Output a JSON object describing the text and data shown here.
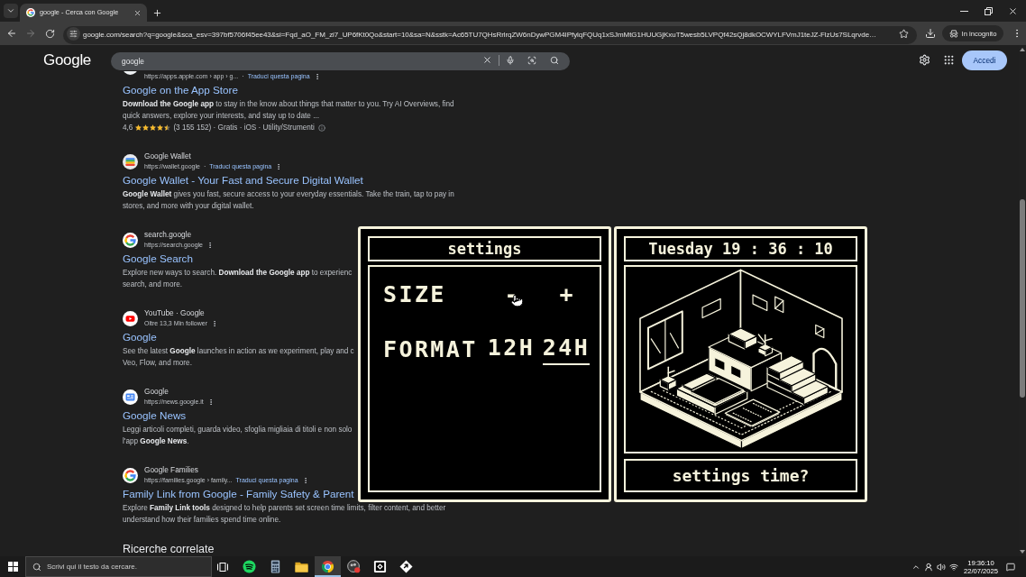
{
  "browser": {
    "tabs": [
      {
        "title": "google - Cerca con Google",
        "selected": true
      }
    ],
    "url": "google.com/search?q=google&sca_esv=397bf5706f45ee43&si=Fqd_aO_FM_zi7_UP6fKt0Qo&start=10&sa=N&sstk=Ac65TU7QHsRrlrqZW6nDywPGM4IPfylqFQUq1xSJmMtG1HUUGjKxuT5wesb5LVPQf42sQj8dkOCWYLFVmJ1teJZ-FlzUs7SLqrvde…",
    "incognito_label": "In incognito"
  },
  "google_header": {
    "logo": "Google",
    "query": "google",
    "sign_in": "Accedi"
  },
  "results": [
    {
      "kind": "cut-off",
      "cite": "https://apps.apple.com › app › g...",
      "cite_separator": "·",
      "translate_link": "Traduci questa pagina",
      "title": "Google on the App Store",
      "snippet_lines": [
        "**Download the Google app** to stay in the know about things that matter to you. Try AI Overviews, find",
        "quick answers, explore your interests, and stay up to date ..."
      ],
      "rating": {
        "score": "4,6",
        "stars": 4.5,
        "details": "(3 155 152) · Gratis · iOS · Utility/Strumenti"
      }
    },
    {
      "kind": "wallet",
      "site": "Google Wallet",
      "cite": "https://wallet.google",
      "cite_separator": "·",
      "translate_link": "Traduci questa pagina",
      "title": "Google Wallet - Your Fast and Secure Digital Wallet",
      "snippet_lines": [
        "**Google Wallet** gives you fast, secure access to your everyday essentials. Take the train, tap to pay in",
        "stores, and more with your digital wallet."
      ]
    },
    {
      "kind": "g",
      "site": "search.google",
      "cite": "https://search.google",
      "title": "Google Search",
      "snippet_lines": [
        "Explore new ways to search. **Download the Google app** to experienc",
        "search, and more."
      ]
    },
    {
      "kind": "video",
      "site": "YouTube · Google",
      "cite": "Oltre 13,3 Mln follower",
      "title": "Google",
      "snippet_lines": [
        "See the latest **Google** launches in action as we experiment, play and c",
        "Veo, Flow, and more."
      ]
    },
    {
      "kind": "news",
      "site": "Google",
      "cite": "https://news.google.it",
      "title": "Google News",
      "snippet_lines": [
        "Leggi articoli completi, guarda video, sfoglia migliaia di titoli e non solo",
        "l'app **Google News**."
      ]
    },
    {
      "kind": "g",
      "site": "Google Families",
      "cite": "https://families.google › family...",
      "translate_link": "Traduci questa pagina",
      "title": "Family Link from Google - Family Safety & Parent",
      "snippet_lines": [
        "Explore **Family Link tools** designed to help parents set screen time limits, filter content, and better",
        "understand how their families spend time online."
      ]
    }
  ],
  "related_heading": "Ricerche correlate",
  "widget": {
    "settings": {
      "title": "settings",
      "size_label": "SIZE",
      "decrease": "-",
      "increase": "+",
      "format_label": "FORMAT",
      "formats": [
        {
          "label": "12H",
          "selected": false
        },
        {
          "label": "24H",
          "selected": true
        }
      ]
    },
    "clock": {
      "title": "Tuesday 19 : 36 : 10",
      "caption": "settings time?"
    }
  },
  "taskbar": {
    "search_placeholder": "Scrivi qui il testo da cercare.",
    "apps": [
      {
        "kind": "music",
        "selected": false
      },
      {
        "kind": "calculator",
        "selected": false
      },
      {
        "kind": "folder",
        "selected": false
      },
      {
        "kind": "browser",
        "selected": true
      },
      {
        "kind": "recorder",
        "selected": false
      },
      {
        "kind": "square",
        "selected": false
      },
      {
        "kind": "diamond",
        "selected": false
      }
    ],
    "time": "19:36:10",
    "date": "22/07/2025"
  }
}
